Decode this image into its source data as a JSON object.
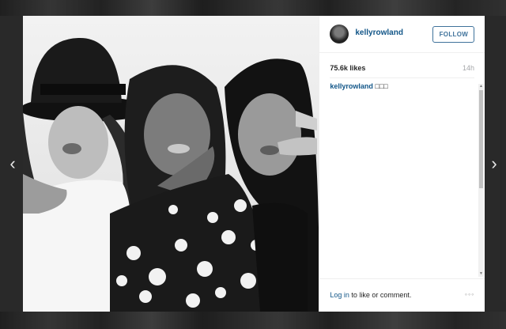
{
  "post": {
    "username": "kellyrowland",
    "follow_label": "FOLLOW",
    "likes": "75.6k likes",
    "timestamp": "14h",
    "caption_user": "kellyrowland",
    "caption_text": "□□□",
    "login_link": "Log in",
    "login_rest": " to like or comment.",
    "more_icon": "◦◦◦"
  },
  "nav": {
    "prev_icon": "‹",
    "next_icon": "›"
  },
  "icons": {
    "prev": "chevron-left-icon",
    "next": "chevron-right-icon",
    "more": "more-options-icon"
  },
  "colors": {
    "link": "#125688",
    "follow_border": "#3f729b",
    "text": "#262626",
    "muted": "#a5a7aa"
  }
}
